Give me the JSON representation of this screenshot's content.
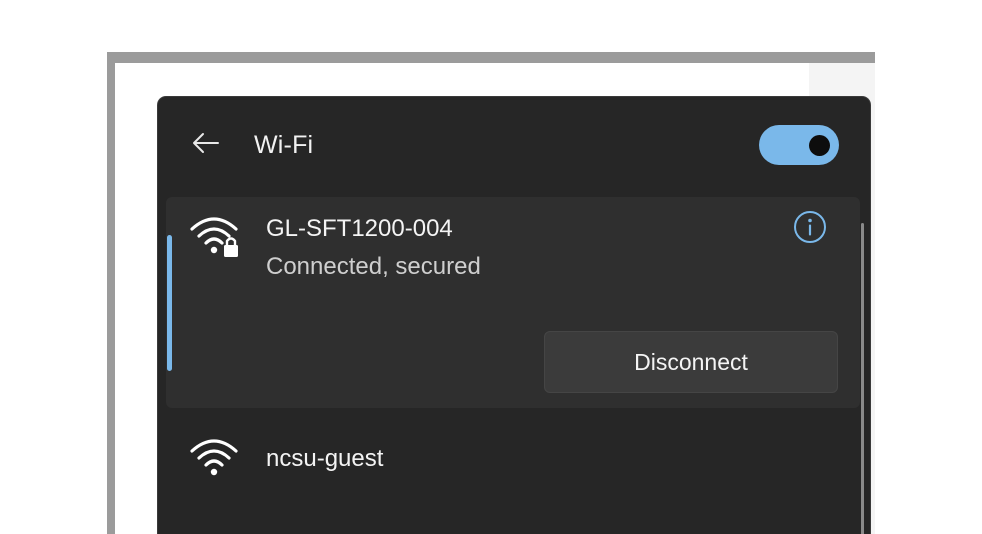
{
  "panel": {
    "title": "Wi-Fi",
    "back_icon": "arrow-left-icon",
    "wifi_toggle": {
      "state": "on",
      "accent_color": "#7ab8ea"
    }
  },
  "networks": [
    {
      "name": "GL-SFT1200-004",
      "status": "Connected, secured",
      "icon": "wifi-secured-icon",
      "info_icon": "info-icon",
      "action_label": "Disconnect",
      "selected": true
    },
    {
      "name": "ncsu-guest",
      "icon": "wifi-icon",
      "selected": false
    }
  ]
}
